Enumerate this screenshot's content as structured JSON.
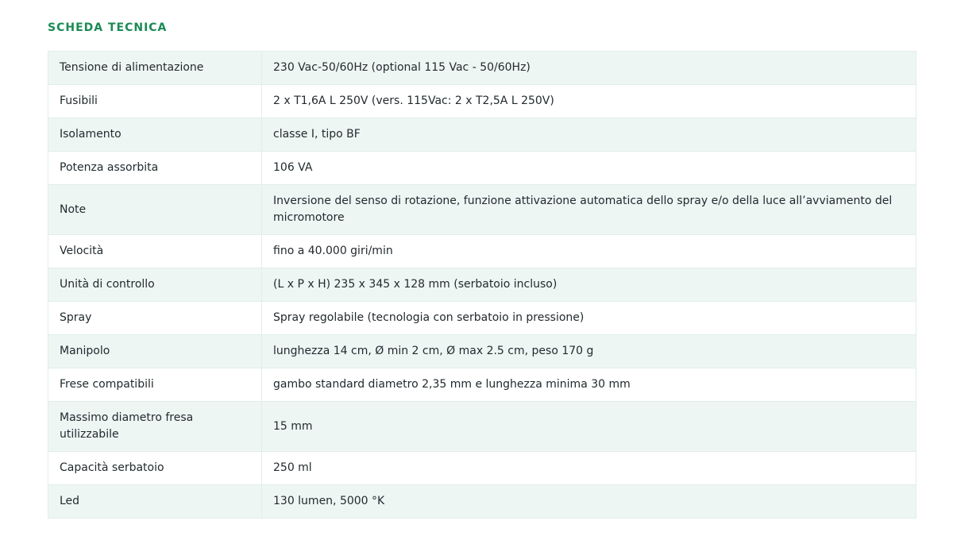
{
  "section": {
    "title": "SCHEDA TECNICA"
  },
  "specs": [
    {
      "label": "Tensione di alimentazione",
      "value": "230 Vac-50/60Hz (optional 115 Vac - 50/60Hz)"
    },
    {
      "label": "Fusibili",
      "value": "2 x T1,6A L 250V (vers. 115Vac: 2 x T2,5A L 250V)"
    },
    {
      "label": "Isolamento",
      "value": "classe I, tipo BF"
    },
    {
      "label": "Potenza assorbita",
      "value": "106 VA"
    },
    {
      "label": "Note",
      "value": "Inversione del senso di rotazione, funzione attivazione automatica dello spray e/o della luce all’avviamento del micromotore"
    },
    {
      "label": "Velocità",
      "value": "fino a 40.000 giri/min"
    },
    {
      "label": "Unità di controllo",
      "value": "(L x P x H) 235 x 345 x 128 mm (serbatoio incluso)"
    },
    {
      "label": "Spray",
      "value": "Spray regolabile (tecnologia con serbatoio in pressione)"
    },
    {
      "label": "Manipolo",
      "value": "lunghezza 14 cm, Ø min 2 cm, Ø max 2.5 cm, peso 170 g"
    },
    {
      "label": "Frese compatibili",
      "value": "gambo standard diametro 2,35 mm e lunghezza minima 30 mm"
    },
    {
      "label": "Massimo diametro fresa utilizzabile",
      "value": "15 mm"
    },
    {
      "label": "Capacità serbatoio",
      "value": "250 ml"
    },
    {
      "label": "Led",
      "value": "130 lumen, 5000 °K"
    }
  ]
}
